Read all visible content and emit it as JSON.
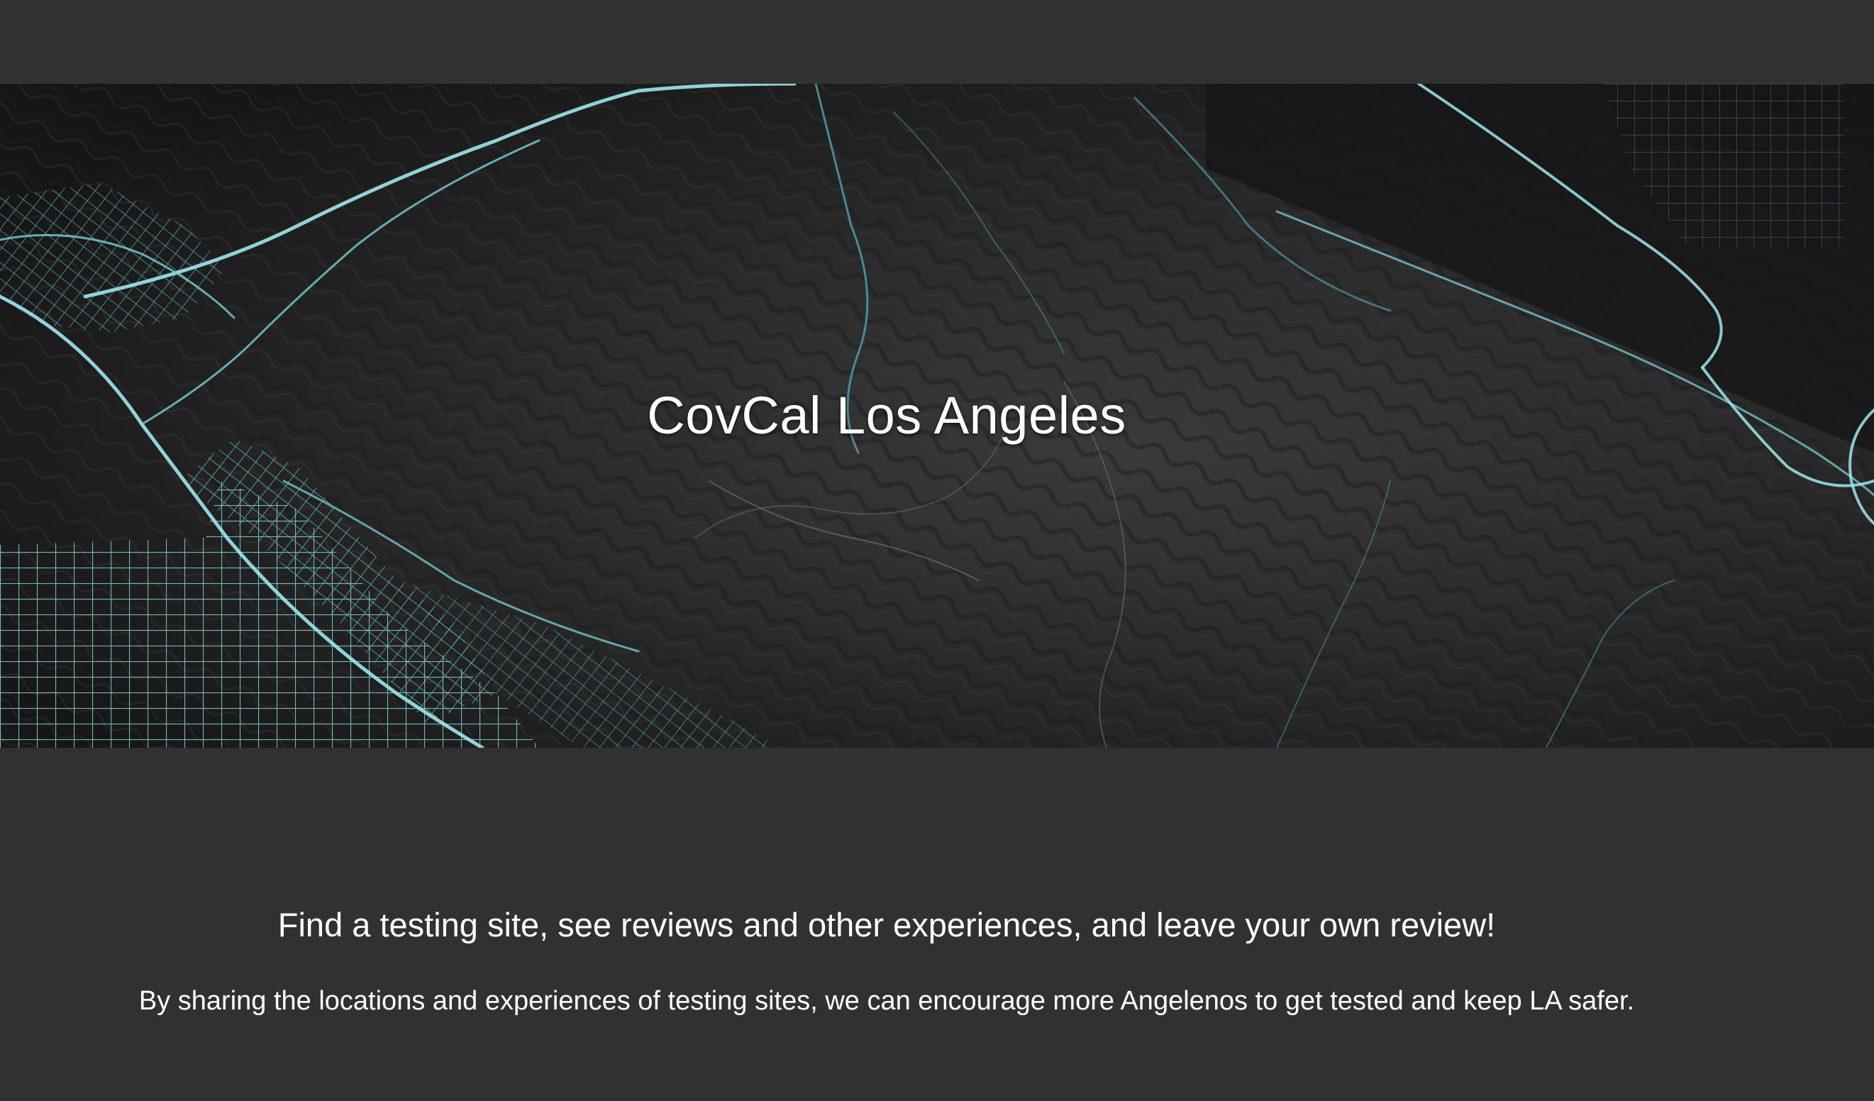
{
  "hero": {
    "title": "CovCal Los Angeles",
    "background": "dark-terrain-map-image"
  },
  "main": {
    "tagline": "Find a testing site, see reviews and other experiences, and leave your own review!",
    "description": "By sharing the locations and experiences of testing sites, we can encourage more Angelenos to get tested and keep LA safer."
  },
  "colors": {
    "page_background": "#313131",
    "map_roads": "#5fc4d0",
    "map_terrain": "#2a2a2a",
    "text": "#ffffff"
  }
}
